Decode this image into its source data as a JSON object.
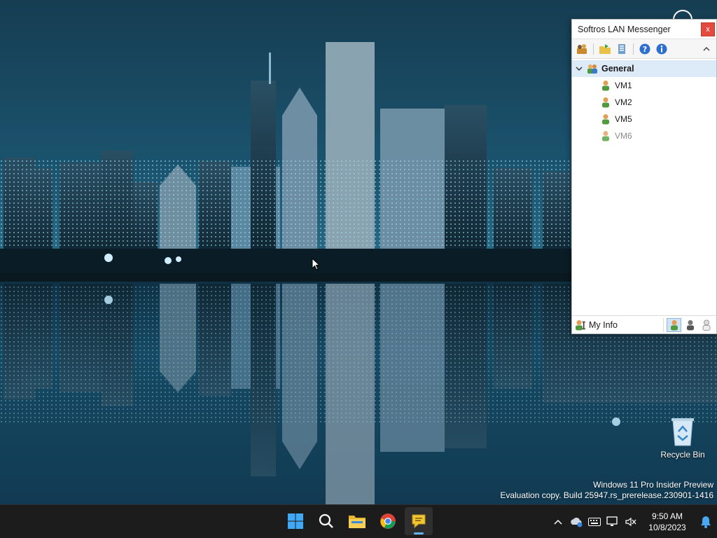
{
  "messenger": {
    "title": "Softros LAN Messenger",
    "close_label": "x",
    "group": {
      "name": "General"
    },
    "contacts": [
      {
        "name": "VM1",
        "status": "online"
      },
      {
        "name": "VM2",
        "status": "online"
      },
      {
        "name": "VM5",
        "status": "online"
      },
      {
        "name": "VM6",
        "status": "offline"
      }
    ],
    "my_info_label": "My Info"
  },
  "desktop": {
    "recycle_bin_label": "Recycle Bin"
  },
  "watermark": {
    "line1": "Windows 11 Pro Insider Preview",
    "line2": "Evaluation copy. Build 25947.rs_prerelease.230901-1416"
  },
  "taskbar": {
    "time": "9:50 AM",
    "date": "10/8/2023"
  },
  "colors": {
    "accent": "#60b7f0",
    "group_highlight": "#dcebf7",
    "close_red": "#e3493d"
  }
}
